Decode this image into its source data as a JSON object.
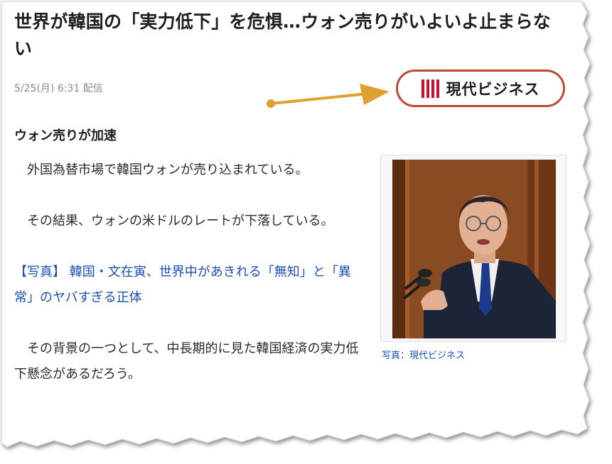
{
  "article": {
    "headline": "世界が韓国の「実力低下」を危惧…ウォン売りがいよいよ止まらない",
    "date": "5/25(月) 6:31 配信",
    "publisher": "現代ビジネス",
    "subheading": "ウォン売りが加速",
    "paragraphs": [
      "外国為替市場で韓国ウォンが売り込まれている。",
      "その結果、ウォンの米ドルのレートが下落している。"
    ],
    "related_link": "【写真】 韓国・文在寅、世界中があきれる「無知」と「異常」のヤバすぎる正体",
    "paragraph_3": "その背景の一つとして、中長期的に見た韓国経済の実力低下懸念があるだろう。",
    "photo_caption": "写真：現代ビジネス"
  },
  "colors": {
    "logo_border": "#bf4a33",
    "logo_bars": "#c8102e",
    "arrow": "#e0a030",
    "link": "#1a4fb5"
  },
  "icons": {
    "publisher_logo_mark": "four-vertical-bars",
    "annotation": "arrow-right"
  }
}
